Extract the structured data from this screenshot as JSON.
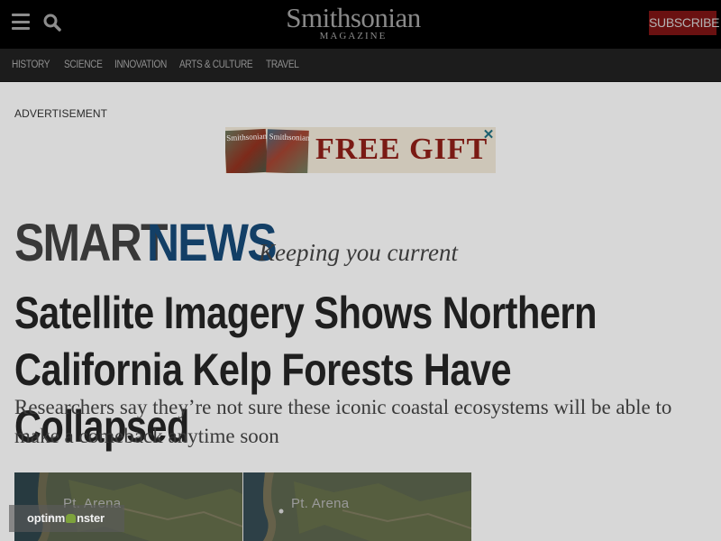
{
  "header": {
    "logo_main": "Smithsonian",
    "logo_sub": "MAGAZINE",
    "subscribe_label": "SUBSCRIBE",
    "menu_icon": "hamburger-menu-icon",
    "search_icon": "search-icon"
  },
  "nav": {
    "items": [
      "HISTORY",
      "SCIENCE",
      "INNOVATION",
      "ARTS & CULTURE",
      "TRAVEL"
    ]
  },
  "ad": {
    "label": "ADVERTISEMENT",
    "banner_text": "FREE GIFT",
    "magazine_title": "Smithsonian",
    "close_icon": "close-icon"
  },
  "section": {
    "smart": "SMART",
    "news": "NEWS",
    "tagline": "Keeping you current"
  },
  "article": {
    "headline": "Satellite Imagery Shows Northern California Kelp Forests Have Collapsed",
    "subhead": "Researchers say they’re not sure these iconic coastal ecosystems will be able to make a comeback anytime soon",
    "image_labels": [
      "Pt. Arena",
      "Pt. Arena"
    ]
  },
  "widget": {
    "optin_prefix": "optinm",
    "optin_suffix": "nster"
  },
  "colors": {
    "topbar": "#000000",
    "navbar": "#1c1c1c",
    "subscribe_bg": "#6a1111",
    "smart": "#383838",
    "news": "#133f66",
    "page_bg": "#d7d7d7"
  }
}
